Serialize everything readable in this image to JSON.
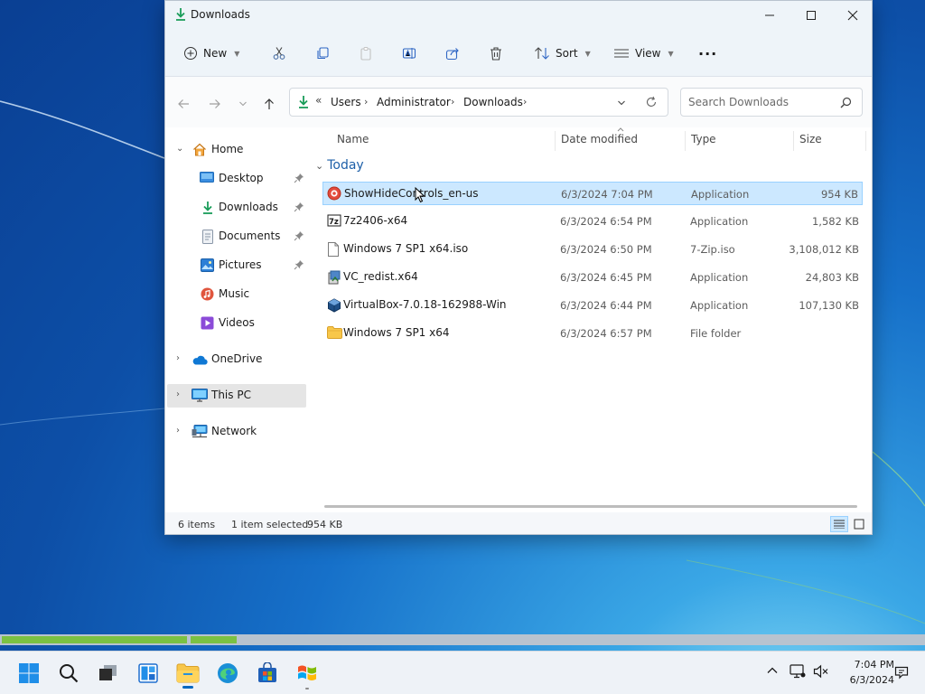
{
  "window": {
    "title": "Downloads",
    "minimize": "—",
    "maximize": "☐",
    "close": "✕"
  },
  "toolbar": {
    "new_label": "New",
    "sort_label": "Sort",
    "view_label": "View",
    "more_label": "···"
  },
  "address": {
    "overflow": "«",
    "crumbs": [
      "Users",
      "Administrator",
      "Downloads"
    ],
    "sep": "›"
  },
  "search": {
    "placeholder": "Search Downloads"
  },
  "nav": {
    "home": "Home",
    "quick": [
      "Desktop",
      "Downloads",
      "Documents",
      "Pictures",
      "Music",
      "Videos"
    ],
    "onedrive": "OneDrive",
    "thispc": "This PC",
    "network": "Network"
  },
  "columns": {
    "name": "Name",
    "date": "Date modified",
    "type": "Type",
    "size": "Size"
  },
  "group_label": "Today",
  "files": [
    {
      "name": "ShowHideControls_en-us",
      "date": "6/3/2024 7:04 PM",
      "type": "Application",
      "size": "954 KB"
    },
    {
      "name": "7z2406-x64",
      "date": "6/3/2024 6:54 PM",
      "type": "Application",
      "size": "1,582 KB"
    },
    {
      "name": "Windows 7 SP1 x64.iso",
      "date": "6/3/2024 6:50 PM",
      "type": "7-Zip.iso",
      "size": "3,108,012 KB"
    },
    {
      "name": "VC_redist.x64",
      "date": "6/3/2024 6:45 PM",
      "type": "Application",
      "size": "24,803 KB"
    },
    {
      "name": "VirtualBox-7.0.18-162988-Win",
      "date": "6/3/2024 6:44 PM",
      "type": "Application",
      "size": "107,130 KB"
    },
    {
      "name": "Windows 7 SP1 x64",
      "date": "6/3/2024 6:57 PM",
      "type": "File folder",
      "size": ""
    }
  ],
  "status": {
    "count": "6 items",
    "selected": "1 item selected",
    "size": "954 KB"
  },
  "progress": {
    "segment1_fraction": 0.2,
    "segment2_fraction": 0.05
  },
  "clock": {
    "time": "7:04 PM",
    "date": "6/3/2024"
  },
  "icons": {
    "title": "download-arrow-icon",
    "toolbar": [
      "plus-icon",
      "cut-icon",
      "copy-icon",
      "paste-icon",
      "rename-icon",
      "share-icon",
      "delete-icon",
      "sort-icon",
      "view-icon"
    ],
    "taskbar": [
      "windows-start-icon",
      "search-icon",
      "task-view-icon",
      "widgets-icon",
      "file-explorer-icon",
      "edge-icon",
      "store-icon",
      "windows7-setup-icon"
    ]
  },
  "colors": {
    "accent": "#0067c0",
    "selection": "#cce8ff",
    "progress": "#7ac143",
    "group": "#1d5fa8"
  }
}
